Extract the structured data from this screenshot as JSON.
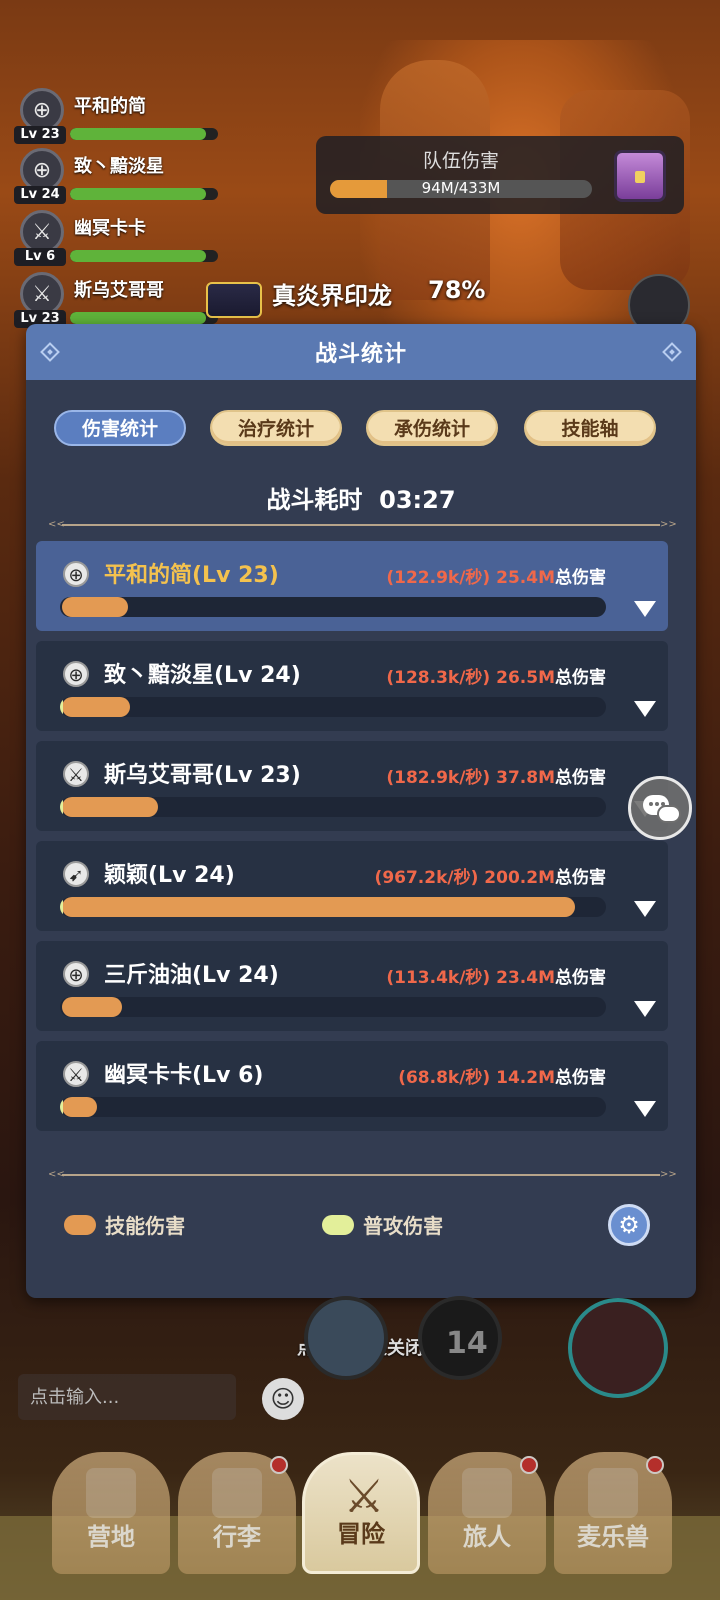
{
  "team_members": [
    {
      "name": "平和的简",
      "level": "Lv 23",
      "icon": "crosshair-icon"
    },
    {
      "name": "致丶黯淡星",
      "level": "Lv 24",
      "icon": "crosshair-icon"
    },
    {
      "name": "幽冥卡卡",
      "level": "Lv 6",
      "icon": "sword-icon"
    },
    {
      "name": "斯乌艾哥哥",
      "level": "Lv 23",
      "icon": "sword-icon"
    }
  ],
  "team_damage": {
    "label": "队伍伤害",
    "value": "94M/433M",
    "fraction": 0.217
  },
  "boss": {
    "name": "真炎界印龙",
    "percent": "78%"
  },
  "modal": {
    "title": "战斗统计",
    "tabs": [
      {
        "label": "伤害统计",
        "active": true
      },
      {
        "label": "治疗统计",
        "active": false
      },
      {
        "label": "承伤统计",
        "active": false
      },
      {
        "label": "技能轴",
        "active": false
      }
    ],
    "duration_label": "战斗耗时",
    "duration_value": "03:27",
    "total_suffix": "总伤害",
    "players": [
      {
        "name": "平和的简(Lv 23)",
        "icon": "crosshair-icon",
        "rate": "(122.9k/秒)",
        "total": "25.4M",
        "skill_fraction": 0.12,
        "normal_fraction": 0.0,
        "highlight": true
      },
      {
        "name": "致丶黯淡星(Lv 24)",
        "icon": "crosshair-icon",
        "rate": "(128.3k/秒)",
        "total": "26.5M",
        "skill_fraction": 0.125,
        "normal_fraction": 0.005,
        "highlight": false
      },
      {
        "name": "斯乌艾哥哥(Lv 23)",
        "icon": "sword-icon",
        "rate": "(182.9k/秒)",
        "total": "37.8M",
        "skill_fraction": 0.175,
        "normal_fraction": 0.005,
        "highlight": false
      },
      {
        "name": "颖颖(Lv 24)",
        "icon": "archer-icon",
        "rate": "(967.2k/秒)",
        "total": "200.2M",
        "skill_fraction": 0.94,
        "normal_fraction": 0.005,
        "highlight": false
      },
      {
        "name": "三斤油油(Lv 24)",
        "icon": "crosshair-icon",
        "rate": "(113.4k/秒)",
        "total": "23.4M",
        "skill_fraction": 0.11,
        "normal_fraction": 0.0,
        "highlight": false
      },
      {
        "name": "幽冥卡卡(Lv 6)",
        "icon": "sword-icon",
        "rate": "(68.8k/秒)",
        "total": "14.2M",
        "skill_fraction": 0.065,
        "normal_fraction": 0.005,
        "highlight": false
      }
    ],
    "legend": [
      {
        "label": "技能伤害",
        "color": "#e39a53"
      },
      {
        "label": "普攻伤害",
        "color": "#e3ef9a"
      }
    ]
  },
  "close_hint": "点击空白处关闭",
  "skill_counter": "14",
  "chat": {
    "placeholder": "点击输入..."
  },
  "nav": [
    {
      "label": "营地",
      "badge": false,
      "active": false
    },
    {
      "label": "行李",
      "badge": true,
      "active": false
    },
    {
      "label": "冒险",
      "badge": false,
      "active": true
    },
    {
      "label": "旅人",
      "badge": true,
      "active": false
    },
    {
      "label": "麦乐兽",
      "badge": true,
      "active": false
    }
  ],
  "colors": {
    "accent": "#5b7ec0",
    "skill": "#e39a53",
    "normal": "#e3ef9a",
    "damage_text": "#f0684a",
    "highlight_name": "#f4c24e"
  }
}
